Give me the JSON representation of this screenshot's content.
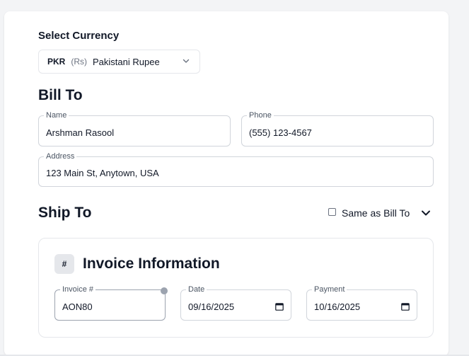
{
  "currency": {
    "section_label": "Select Currency",
    "selected_code": "PKR",
    "selected_symbol": "(Rs)",
    "selected_name": "Pakistani Rupee"
  },
  "bill_to": {
    "heading": "Bill To",
    "name_label": "Name",
    "name_value": "Arshman Rasool",
    "phone_label": "Phone",
    "phone_value": "(555) 123-4567",
    "address_label": "Address",
    "address_value": "123 Main St, Anytown, USA"
  },
  "ship_to": {
    "heading": "Ship To",
    "same_as_label": "Same as Bill To",
    "same_as_checked": false
  },
  "invoice_info": {
    "badge": "#",
    "heading": "Invoice Information",
    "invoice_number_label": "Invoice #",
    "invoice_number_value": "AON80",
    "date_label": "Date",
    "date_value": "09/16/2025",
    "payment_label": "Payment",
    "payment_value": "10/16/2025"
  },
  "icons": {
    "select_chevron": "chevron-down-icon",
    "section_chevron": "chevron-down-icon",
    "calendar": "calendar-icon"
  }
}
